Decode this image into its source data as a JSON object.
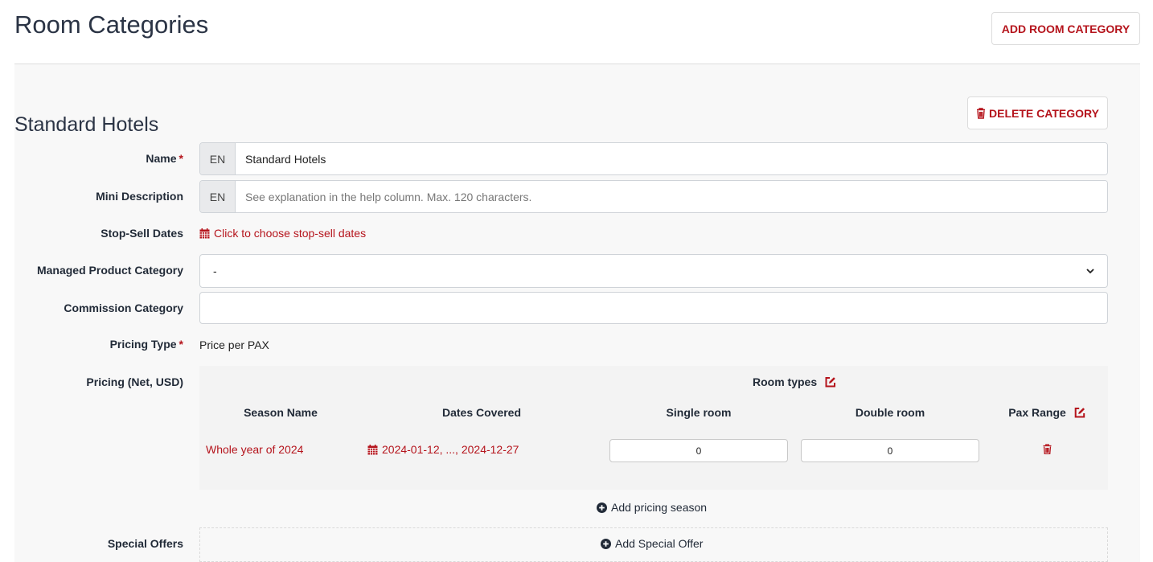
{
  "header": {
    "title": "Room Categories",
    "add_button": "ADD ROOM CATEGORY"
  },
  "category": {
    "title": "Standard Hotels",
    "delete_button": "DELETE CATEGORY",
    "name": {
      "label": "Name",
      "required_mark": "*",
      "lang": "EN",
      "value": "Standard Hotels"
    },
    "mini_description": {
      "label": "Mini Description",
      "lang": "EN",
      "value": "",
      "placeholder": "See explanation in the help column. Max. 120 characters."
    },
    "stop_sell": {
      "label": "Stop-Sell Dates",
      "link": "Click to choose stop-sell dates"
    },
    "managed_product": {
      "label": "Managed Product Category",
      "selected": "-"
    },
    "commission": {
      "label": "Commission Category",
      "value": ""
    },
    "pricing_type": {
      "label": "Pricing Type",
      "required_mark": "*",
      "value": "Price per PAX"
    },
    "pricing": {
      "label": "Pricing (Net, USD)",
      "room_types_header": "Room types",
      "columns": {
        "season": "Season Name",
        "dates": "Dates Covered",
        "single": "Single room",
        "double": "Double room",
        "pax": "Pax Range"
      },
      "rows": [
        {
          "season": "Whole year of 2024",
          "dates": "2024-01-12, ..., 2024-12-27",
          "single": "0",
          "double": "0"
        }
      ],
      "add_season": "Add pricing season"
    },
    "special_offers": {
      "label": "Special Offers",
      "add": "Add Special Offer"
    }
  },
  "colors": {
    "accent": "#b5141c",
    "text": "#222b38",
    "panel": "#f8f8f8"
  },
  "icons": [
    "trash-icon",
    "calendar-icon",
    "chevron-down-icon",
    "edit-icon",
    "plus-circle-icon"
  ]
}
